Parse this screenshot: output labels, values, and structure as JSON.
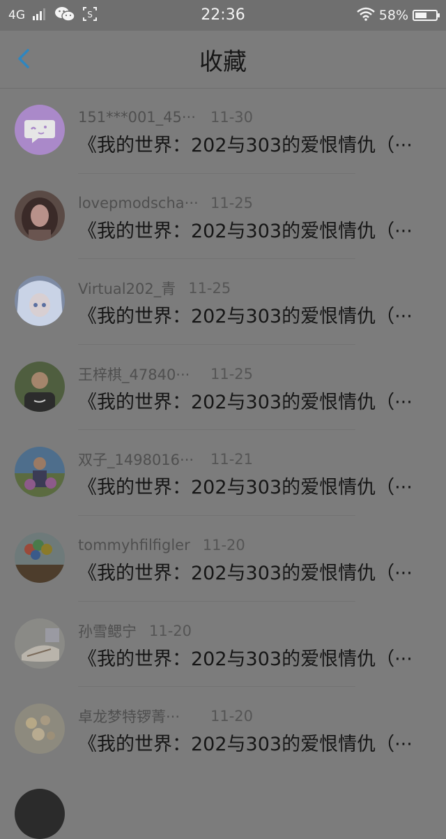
{
  "status_bar": {
    "network": "4G",
    "time": "22:36",
    "battery_percent_text": "58%",
    "battery_level": 0.58,
    "icons": [
      "signal-icon",
      "wechat-icon",
      "screenshot-icon",
      "wifi-icon",
      "battery-icon"
    ]
  },
  "header": {
    "title": "收藏",
    "back_icon": "chevron-left-icon"
  },
  "colors": {
    "accent": "#2f86bf",
    "dim_overlay": "#7c7c7c"
  },
  "items": [
    {
      "name": "151***001_45···",
      "date": "11-30",
      "message": "《我的世界：202与303的爱恨情仇（···"
    },
    {
      "name": "lovepmodscha···",
      "date": "11-25",
      "message": "《我的世界：202与303的爱恨情仇（···"
    },
    {
      "name": "Virtual202_青",
      "date": "11-25",
      "message": "《我的世界：202与303的爱恨情仇（···"
    },
    {
      "name": "王梓棋_47840···",
      "date": "11-25",
      "message": "《我的世界：202与303的爱恨情仇（···"
    },
    {
      "name": "双子_1498016···",
      "date": "11-21",
      "message": "《我的世界：202与303的爱恨情仇（···"
    },
    {
      "name": "tommyhfilfigler",
      "date": "11-20",
      "message": "《我的世界：202与303的爱恨情仇（···"
    },
    {
      "name": "孙雪鳃宁",
      "date": "11-20",
      "message": "《我的世界：202与303的爱恨情仇（···"
    },
    {
      "name": "卓龙梦特锣菁···",
      "date": "11-20",
      "message": "《我的世界：202与303的爱恨情仇（···"
    }
  ]
}
